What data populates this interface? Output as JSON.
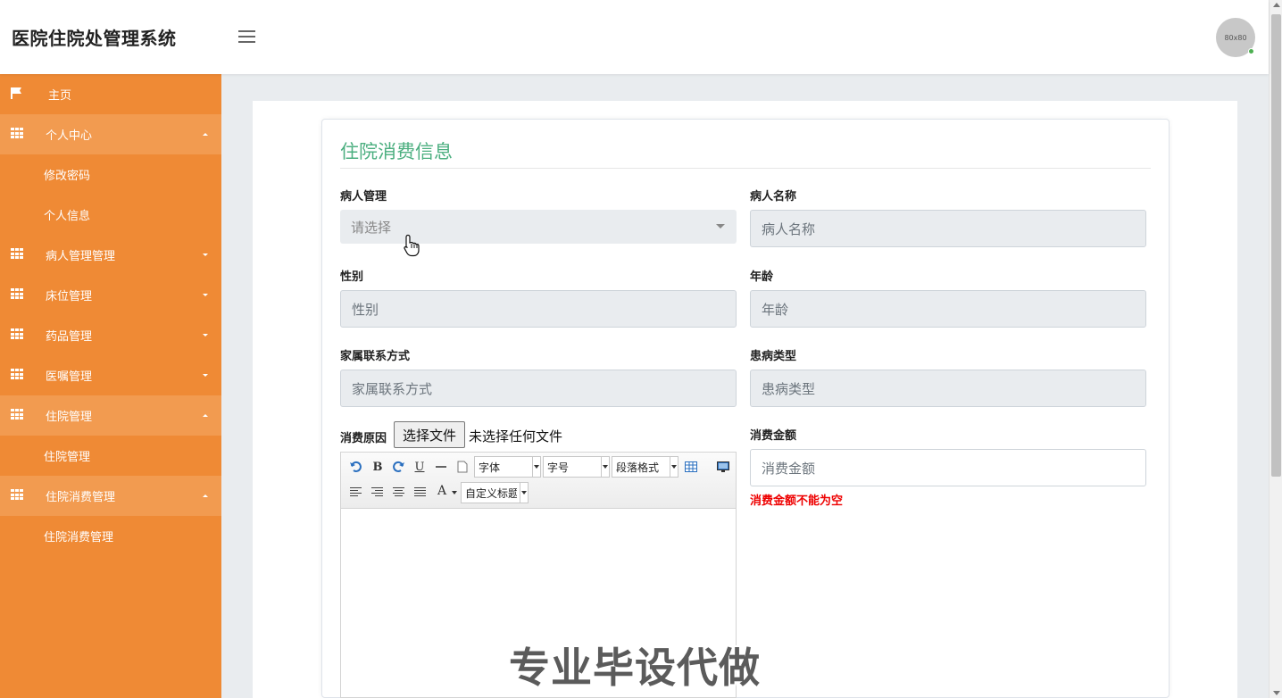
{
  "app": {
    "title": "医院住院处管理系统",
    "avatar_text": "80x80"
  },
  "sidebar": {
    "items": [
      {
        "label": "主页",
        "icon": "flag-icon",
        "open": false,
        "sub": []
      },
      {
        "label": "个人中心",
        "icon": "grid-icon",
        "open": true,
        "sub": [
          "修改密码",
          "个人信息"
        ]
      },
      {
        "label": "病人管理管理",
        "icon": "grid-icon",
        "open": false,
        "sub": []
      },
      {
        "label": "床位管理",
        "icon": "grid-icon",
        "open": false,
        "sub": []
      },
      {
        "label": "药品管理",
        "icon": "grid-icon",
        "open": false,
        "sub": []
      },
      {
        "label": "医嘱管理",
        "icon": "grid-icon",
        "open": false,
        "sub": []
      },
      {
        "label": "住院管理",
        "icon": "grid-icon",
        "open": true,
        "sub": [
          "住院管理"
        ]
      },
      {
        "label": "住院消费管理",
        "icon": "grid-icon",
        "open": true,
        "sub": [
          "住院消费管理"
        ]
      }
    ]
  },
  "form": {
    "title": "住院消费信息",
    "patient_select": {
      "label": "病人管理",
      "placeholder": "请选择"
    },
    "patient_name": {
      "label": "病人名称",
      "placeholder": "病人名称"
    },
    "gender": {
      "label": "性别",
      "placeholder": "性别"
    },
    "age": {
      "label": "年龄",
      "placeholder": "年龄"
    },
    "family_contact": {
      "label": "家属联系方式",
      "placeholder": "家属联系方式"
    },
    "disease_type": {
      "label": "患病类型",
      "placeholder": "患病类型"
    },
    "reason": {
      "label": "消费原因",
      "file_button": "选择文件",
      "file_status": "未选择任何文件"
    },
    "amount": {
      "label": "消费金额",
      "placeholder": "消费金额",
      "error": "消费金额不能为空"
    }
  },
  "editor": {
    "font_family": "字体",
    "font_size": "字号",
    "paragraph": "段落格式",
    "custom_heading": "自定义标题",
    "bold": "B",
    "underline": "U",
    "font_color": "A"
  },
  "watermark": "专业毕设代做",
  "colors": {
    "sidebar": "#ef8a35",
    "sidebar_open": "#f29b50",
    "title": "#4caf80",
    "error": "#e00000"
  }
}
